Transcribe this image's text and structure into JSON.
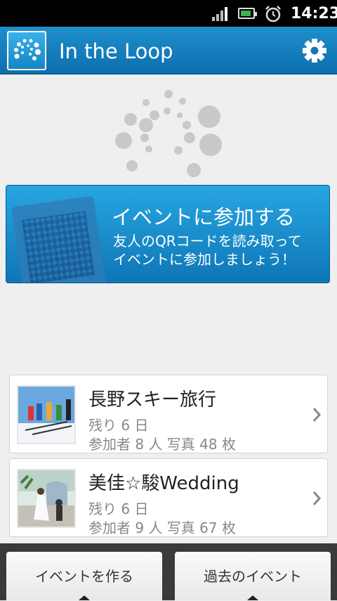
{
  "status_bar": {
    "time": "14:23"
  },
  "app": {
    "title": "In the Loop"
  },
  "join_banner": {
    "title": "イベントに参加する",
    "description": "友人のQRコードを読み取って\nイベントに参加しましょう！"
  },
  "events": [
    {
      "name": "長野スキー旅行",
      "remaining": "残り 6 日",
      "stats": "参加者 8 人 写真 48 枚"
    },
    {
      "name": "美佳☆駿Wedding",
      "remaining": "残り 6 日",
      "stats": "参加者 9 人 写真 67 枚"
    }
  ],
  "bottom": {
    "create_label": "イベントを作る",
    "past_label": "過去のイベント"
  },
  "colors": {
    "accent": "#1a86c6",
    "banner": "#1b8fd1"
  }
}
